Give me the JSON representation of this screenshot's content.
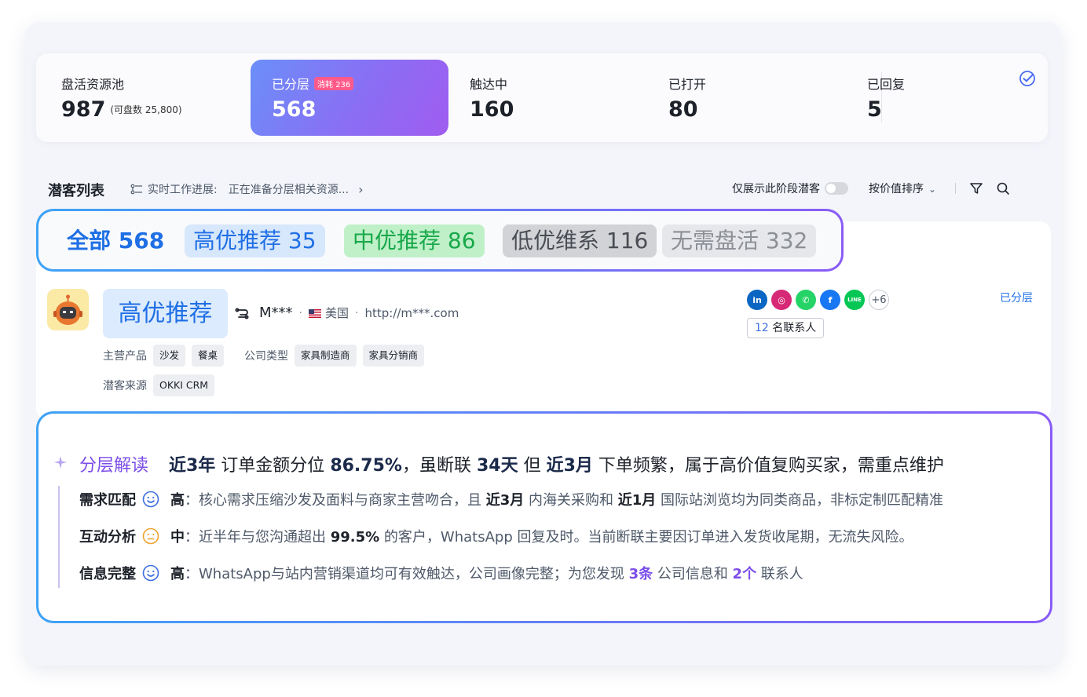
{
  "stats": [
    {
      "label": "盘活资源池",
      "value": "987",
      "sub": "(可盘数 25,800)"
    },
    {
      "label": "已分层",
      "value": "568",
      "badge": "消耗 236",
      "active": true
    },
    {
      "label": "触达中",
      "value": "160"
    },
    {
      "label": "已打开",
      "value": "80"
    },
    {
      "label": "已回复",
      "value": "5"
    }
  ],
  "list_header": {
    "title": "潜客列表",
    "progress_label": "实时工作进展:",
    "progress_text": "正在准备分层相关资源...",
    "only_stage_label": "仅展示此阶段潜客",
    "sort_label": "按价值排序"
  },
  "tabs": [
    {
      "label": "全部",
      "count": "568"
    },
    {
      "label": "高优推荐",
      "count": "35"
    },
    {
      "label": "中优推荐",
      "count": "86"
    },
    {
      "label": "低优维系",
      "count": "116"
    },
    {
      "label": "无需盘活",
      "count": "332"
    }
  ],
  "company": {
    "tier": "高优推荐",
    "name": "M***",
    "country": "美国",
    "website": "http://m***.com",
    "main_products_label": "主营产品",
    "main_products": [
      "沙发",
      "餐桌"
    ],
    "company_type_label": "公司类型",
    "company_types": [
      "家具制造商",
      "家具分销商"
    ],
    "source_label": "潜客来源",
    "source": "OKKI CRM",
    "socials": [
      {
        "name": "linkedin-icon",
        "text": "in",
        "color": "#0a66c2"
      },
      {
        "name": "instagram-icon",
        "text": "◎",
        "color": "#d62976"
      },
      {
        "name": "whatsapp-icon",
        "text": "✆",
        "color": "#25d366"
      },
      {
        "name": "facebook-icon",
        "text": "f",
        "color": "#1877f2"
      },
      {
        "name": "line-icon",
        "text": "LINE",
        "color": "#06c755"
      }
    ],
    "socials_more": "+6",
    "contacts_count": "12",
    "contacts_label": "名联系人",
    "status": "已分层"
  },
  "analysis": {
    "title": "分层解读",
    "summary": {
      "p1": "近3年",
      "p2": " 订单金额分位 ",
      "p3": "86.75%",
      "p4": "，虽断联 ",
      "p5": "34天",
      "p6": " 但 ",
      "p7": "近3月",
      "p8": " 下单频繁，属于高价值复购买家，需重点维护"
    },
    "rows": [
      {
        "name": "需求匹配",
        "level": "高",
        "face": "happy",
        "t1": "：核心需求压缩沙发及面料与商家主营吻合，且 ",
        "b1": "近3月",
        "t2": " 内海关采购和 ",
        "b2": "近1月",
        "t3": " 国际站浏览均为同类商品，非标定制匹配精准"
      },
      {
        "name": "互动分析",
        "level": "中",
        "face": "neutral",
        "t1": "：近半年与您沟通超出 ",
        "b1": "99.5%",
        "t2": " 的客户，WhatsApp 回复及时。当前断联主要因订单进入发货收尾期，无流失风险。"
      },
      {
        "name": "信息完整",
        "level": "高",
        "face": "happy",
        "t1": "：WhatsApp与站内营销渠道均可有效触达，公司画像完整；为您发现 ",
        "h1": "3条",
        "t2": " 公司信息和 ",
        "h2": "2个",
        "t3": " 联系人"
      }
    ]
  }
}
